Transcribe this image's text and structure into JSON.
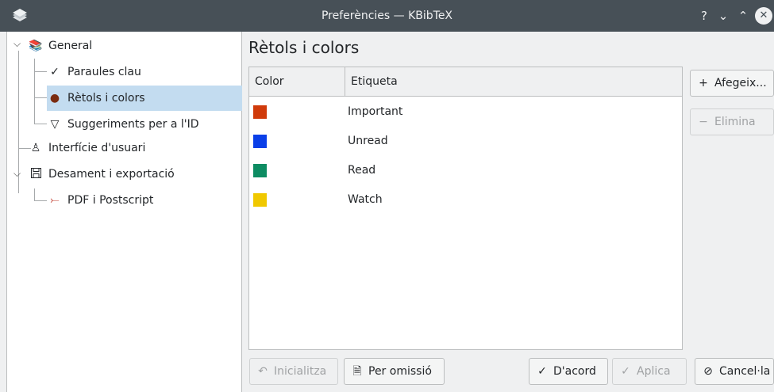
{
  "window": {
    "title": "Preferències — KBibTeX",
    "help_glyph": "?",
    "minimize_glyph": "⌄",
    "maximize_glyph": "⌃",
    "close_glyph": "✕",
    "app_icon": "kbibtex-books-icon"
  },
  "tree": {
    "items": [
      {
        "label": "General",
        "icon": "books-icon",
        "level": 0,
        "expanded": true
      },
      {
        "label": "Paraules clau",
        "icon": "checkmark-icon",
        "level": 1
      },
      {
        "label": "Rètols i colors",
        "icon": "color-palette-icon",
        "level": 1,
        "selected": true
      },
      {
        "label": "Suggeriments per a l'ID",
        "icon": "funnel-icon",
        "level": 1
      },
      {
        "label": "Interfície d'usuari",
        "icon": "user-icon",
        "level": 0
      },
      {
        "label": "Desament i exportació",
        "icon": "floppy-disk-icon",
        "level": 0,
        "expanded": true
      },
      {
        "label": "PDF i Postscript",
        "icon": "pdf-icon",
        "level": 1
      }
    ],
    "glyphs": {
      "expanded": "⌵",
      "books": "📚",
      "check": "✓",
      "palette": "●",
      "funnel": "▽",
      "user": "♙",
      "floppy": "💾",
      "pdf": "⤚"
    }
  },
  "page": {
    "title": "Rètols i colors",
    "columns": [
      "Color",
      "Etiqueta"
    ],
    "rows": [
      {
        "label": "Important",
        "color": "#d03a0a"
      },
      {
        "label": "Unread",
        "color": "#0a3fe8"
      },
      {
        "label": "Read",
        "color": "#0d8c62"
      },
      {
        "label": "Watch",
        "color": "#f0c800"
      }
    ]
  },
  "buttons": {
    "add": {
      "label": "Afegeix...",
      "glyph": "+"
    },
    "remove": {
      "label": "Elimina",
      "glyph": "−"
    },
    "reset": {
      "label": "Inicialitza",
      "glyph": "↶"
    },
    "defaults": {
      "label": "Per omissió",
      "glyph": "🗎"
    },
    "ok": {
      "label": "D'acord",
      "glyph": "✓"
    },
    "apply": {
      "label": "Aplica",
      "glyph": "✓"
    },
    "cancel": {
      "label": "Cancel·la",
      "glyph": "⊘"
    }
  },
  "colors": {
    "titlebar": "#475057",
    "selection": "#c3dcf0",
    "window_bg": "#eff0f1"
  }
}
